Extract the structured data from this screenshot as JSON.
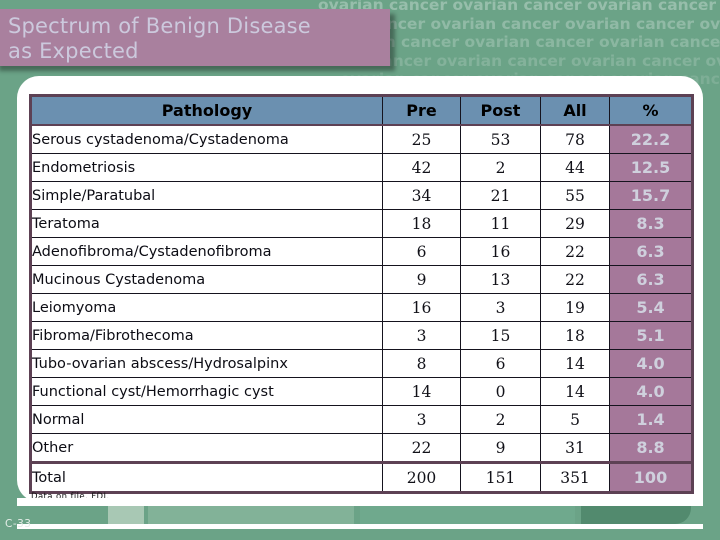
{
  "slide": {
    "title_lines": [
      "Spectrum of Benign Disease",
      "as Expected"
    ],
    "background_watermark_text": "ovarian cancer ovarian cancer ovarian cancer ovarian cancer ovarian cancer",
    "source_note": "Data on file, FDI.",
    "slide_number": "C-33",
    "colors": {
      "background_green": "#6ba387",
      "title_plate_mauve": "#a9809e",
      "title_text": "#ccc9dd",
      "table_header_blue": "#6b90b0",
      "percent_column_mauve": "#a5789a",
      "table_border": "#5d4154",
      "panel_white": "#ffffff"
    }
  },
  "table": {
    "columns": [
      "Pathology",
      "Pre",
      "Post",
      "All",
      "%"
    ],
    "rows": [
      {
        "pathology": "Serous cystadenoma/Cystadenoma",
        "pre": "25",
        "post": "53",
        "all": "78",
        "pct": "22.2"
      },
      {
        "pathology": "Endometriosis",
        "pre": "42",
        "post": "2",
        "all": "44",
        "pct": "12.5"
      },
      {
        "pathology": "Simple/Paratubal",
        "pre": "34",
        "post": "21",
        "all": "55",
        "pct": "15.7"
      },
      {
        "pathology": "Teratoma",
        "pre": "18",
        "post": "11",
        "all": "29",
        "pct": "8.3"
      },
      {
        "pathology": "Adenofibroma/Cystadenofibroma",
        "pre": "6",
        "post": "16",
        "all": "22",
        "pct": "6.3"
      },
      {
        "pathology": "Mucinous Cystadenoma",
        "pre": "9",
        "post": "13",
        "all": "22",
        "pct": "6.3"
      },
      {
        "pathology": "Leiomyoma",
        "pre": "16",
        "post": "3",
        "all": "19",
        "pct": "5.4"
      },
      {
        "pathology": "Fibroma/Fibrothecoma",
        "pre": "3",
        "post": "15",
        "all": "18",
        "pct": "5.1"
      },
      {
        "pathology": "Tubo-ovarian abscess/Hydrosalpinx",
        "pre": "8",
        "post": "6",
        "all": "14",
        "pct": "4.0"
      },
      {
        "pathology": "Functional cyst/Hemorrhagic cyst",
        "pre": "14",
        "post": "0",
        "all": "14",
        "pct": "4.0"
      },
      {
        "pathology": "Normal",
        "pre": "3",
        "post": "2",
        "all": "5",
        "pct": "1.4"
      },
      {
        "pathology": "Other",
        "pre": "22",
        "post": "9",
        "all": "31",
        "pct": "8.8"
      },
      {
        "pathology": "Total",
        "pre": "200",
        "post": "151",
        "all": "351",
        "pct": "100"
      }
    ]
  }
}
